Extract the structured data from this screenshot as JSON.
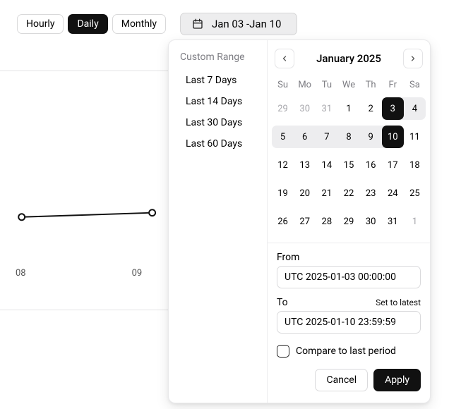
{
  "granularity": {
    "options": [
      "Hourly",
      "Daily",
      "Monthly"
    ],
    "active": "Daily"
  },
  "date_button": {
    "label": "Jan 03 -Jan 10"
  },
  "chart_data": {
    "type": "line",
    "x_ticks": [
      "08",
      "09"
    ],
    "points": [
      {
        "x": 0,
        "y": 0.5
      },
      {
        "x": 1,
        "y": 0.53
      }
    ],
    "ylim": [
      0,
      1
    ]
  },
  "presets": {
    "title": "Custom Range",
    "items": [
      "Last 7 Days",
      "Last 14 Days",
      "Last 30 Days",
      "Last 60 Days"
    ]
  },
  "calendar": {
    "month_title": "January 2025",
    "dow": [
      "Su",
      "Mo",
      "Tu",
      "We",
      "Th",
      "Fr",
      "Sa"
    ],
    "cells": [
      {
        "n": 29,
        "muted": true
      },
      {
        "n": 30,
        "muted": true
      },
      {
        "n": 31,
        "muted": true
      },
      {
        "n": 1
      },
      {
        "n": 2
      },
      {
        "n": 3,
        "startsel": true
      },
      {
        "n": 4,
        "inrange": true,
        "range_end": true
      },
      {
        "n": 5,
        "inrange": true,
        "range_start": true
      },
      {
        "n": 6,
        "inrange": true
      },
      {
        "n": 7,
        "inrange": true
      },
      {
        "n": 8,
        "inrange": true
      },
      {
        "n": 9,
        "inrange": true
      },
      {
        "n": 10,
        "endsel": true
      },
      {
        "n": 11
      },
      {
        "n": 12
      },
      {
        "n": 13
      },
      {
        "n": 14
      },
      {
        "n": 15
      },
      {
        "n": 16
      },
      {
        "n": 17
      },
      {
        "n": 18
      },
      {
        "n": 19
      },
      {
        "n": 20
      },
      {
        "n": 21
      },
      {
        "n": 22
      },
      {
        "n": 23
      },
      {
        "n": 24
      },
      {
        "n": 25
      },
      {
        "n": 26
      },
      {
        "n": 27
      },
      {
        "n": 28
      },
      {
        "n": 29
      },
      {
        "n": 30
      },
      {
        "n": 31
      },
      {
        "n": 1,
        "muted": true
      }
    ]
  },
  "form": {
    "from_label": "From",
    "from_value": "UTC 2025-01-03 00:00:00",
    "to_label": "To",
    "to_value": "UTC 2025-01-10 23:59:59",
    "set_latest": "Set to latest",
    "compare_label": "Compare to last period",
    "cancel": "Cancel",
    "apply": "Apply"
  }
}
